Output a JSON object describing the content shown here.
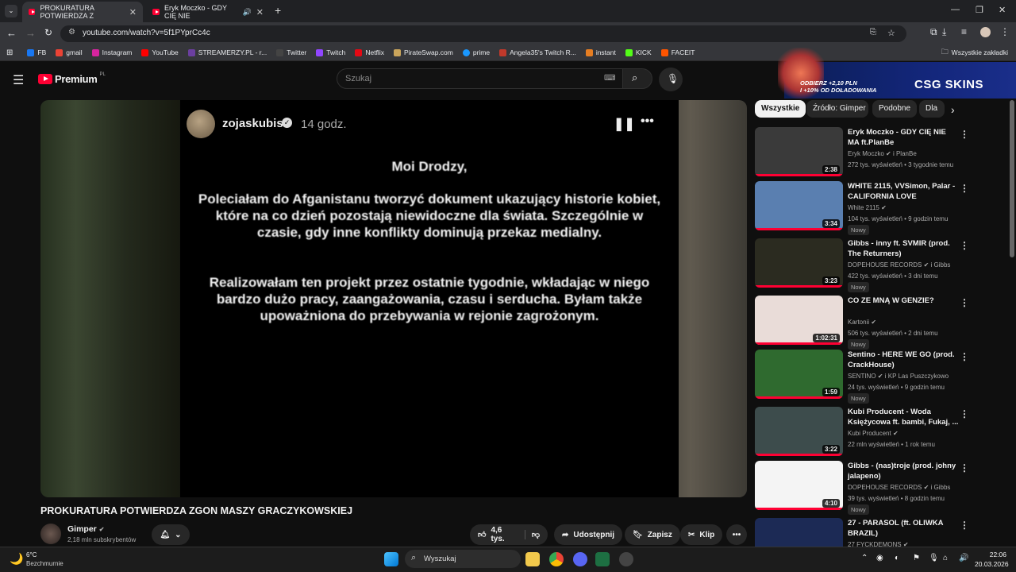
{
  "browser": {
    "tabs": [
      {
        "title": "PROKURATURA POTWIERDZA Z"
      },
      {
        "title": "Eryk Moczko - GDY CIĘ NIE"
      }
    ],
    "new_tab": "+",
    "url": "youtube.com/watch?v=5f1PYprCc4c",
    "bookmarks": [
      "FB",
      "gmail",
      "Instagram",
      "YouTube",
      "STREAMERZY.PL - r...",
      "Twitter",
      "Twitch",
      "Netflix",
      "PirateSwap.com",
      "prime",
      "Angela35's Twitch R...",
      "instant",
      "KICK",
      "FACEIT"
    ],
    "all_bookmarks": "Wszystkie zakładki"
  },
  "youtube": {
    "logo": "Premium",
    "region": "PL",
    "search_placeholder": "Szukaj",
    "ad": {
      "line1": "ODBIERZ +2,10 PLN",
      "line2": "I +10% OD DOŁADOWANIA",
      "brand": "CSG SKINS"
    }
  },
  "story": {
    "username": "zojaskubis",
    "time": "14 godz.",
    "greeting": "Moi Drodzy,",
    "para1": "Poleciałam do Afganistanu tworzyć dokument ukazujący historie kobiet, które na co dzień pozostają niewidoczne dla świata. Szczególnie w czasie, gdy inne konflikty dominują przekaz medialny.",
    "para2": "Realizowałam ten projekt przez ostatnie tygodnie, wkładając w niego bardzo dużo pracy, zaangażowania, czasu i serducha. Byłam także upoważniona do przebywania w rejonie zagrożonym."
  },
  "video": {
    "title": "PROKURATURA POTWIERDZA ZGON MASZY GRACZYKOWSKIEJ",
    "channel": "Gimper",
    "subs": "2,18 mln subskrybentów",
    "likes": "4,6 tys.",
    "share": "Udostępnij",
    "save": "Zapisz",
    "clip": "Klip"
  },
  "chips": [
    "Wszystkie",
    "Źródło: Gimper",
    "Podobne",
    "Dla"
  ],
  "recommendations": [
    {
      "title": "Eryk Moczko - GDY CIĘ NIE MA ft.PlanBe",
      "channel": "Eryk Moczko",
      "collab": "i PlanBe",
      "meta": "272 tys. wyświetleń • 3 tygodnie temu",
      "badge": "",
      "duration": "2:38",
      "thumb": "#3a3a3a"
    },
    {
      "title": "WHITE 2115, VVSimon, Palar - CALIFORNIA LOVE",
      "channel": "White 2115",
      "collab": "",
      "meta": "104 tys. wyświetleń • 9 godzin temu",
      "badge": "Nowy",
      "duration": "3:34",
      "thumb": "#5a7fb0"
    },
    {
      "title": "Gibbs - inny ft. SVMIR (prod. The Returners)",
      "channel": "DOPEHOUSE RECORDS",
      "collab": "i Gibbs",
      "meta": "422 tys. wyświetleń • 3 dni temu",
      "badge": "Nowy",
      "duration": "3:23",
      "thumb": "#2b2b20"
    },
    {
      "title": "CO ZE MNĄ W GENZIE?",
      "channel": "Kartonii",
      "collab": "",
      "meta": "506 tys. wyświetleń • 2 dni temu",
      "badge": "Nowy",
      "duration": "1:02:31",
      "thumb": "#e9dcd8"
    },
    {
      "title": "Sentino - HERE WE GO (prod. CrackHouse)",
      "channel": "SENTINO",
      "collab": "i KP Las Puszczykowo",
      "meta": "24 tys. wyświetleń • 9 godzin temu",
      "badge": "Nowy",
      "duration": "1:59",
      "thumb": "#2f6a2f"
    },
    {
      "title": "Kubi Producent - Woda Księżycowa ft. bambi, Fukaj, ...",
      "channel": "Kubi Producent",
      "collab": "",
      "meta": "22 mln wyświetleń • 1 rok temu",
      "badge": "",
      "duration": "3:22",
      "thumb": "#3d4c4c"
    },
    {
      "title": "Gibbs - (nas)troje (prod. johny jalapeno)",
      "channel": "DOPEHOUSE RECORDS",
      "collab": "i Gibbs",
      "meta": "39 tys. wyświetleń • 8 godzin temu",
      "badge": "Nowy",
      "duration": "4:10",
      "thumb": "#f4f4f4"
    },
    {
      "title": "27 - PARASOL (ft. OLIWKA BRAZIL)",
      "channel": "27 FYCKDEMONS",
      "collab": "",
      "meta": "",
      "badge": "",
      "duration": "",
      "thumb": "#1c2a55"
    }
  ],
  "taskbar": {
    "weather_temp": "6°C",
    "weather_desc": "Bezchmurnie",
    "search": "Wyszukaj",
    "time": "22:06",
    "date": "20.03.2026"
  }
}
